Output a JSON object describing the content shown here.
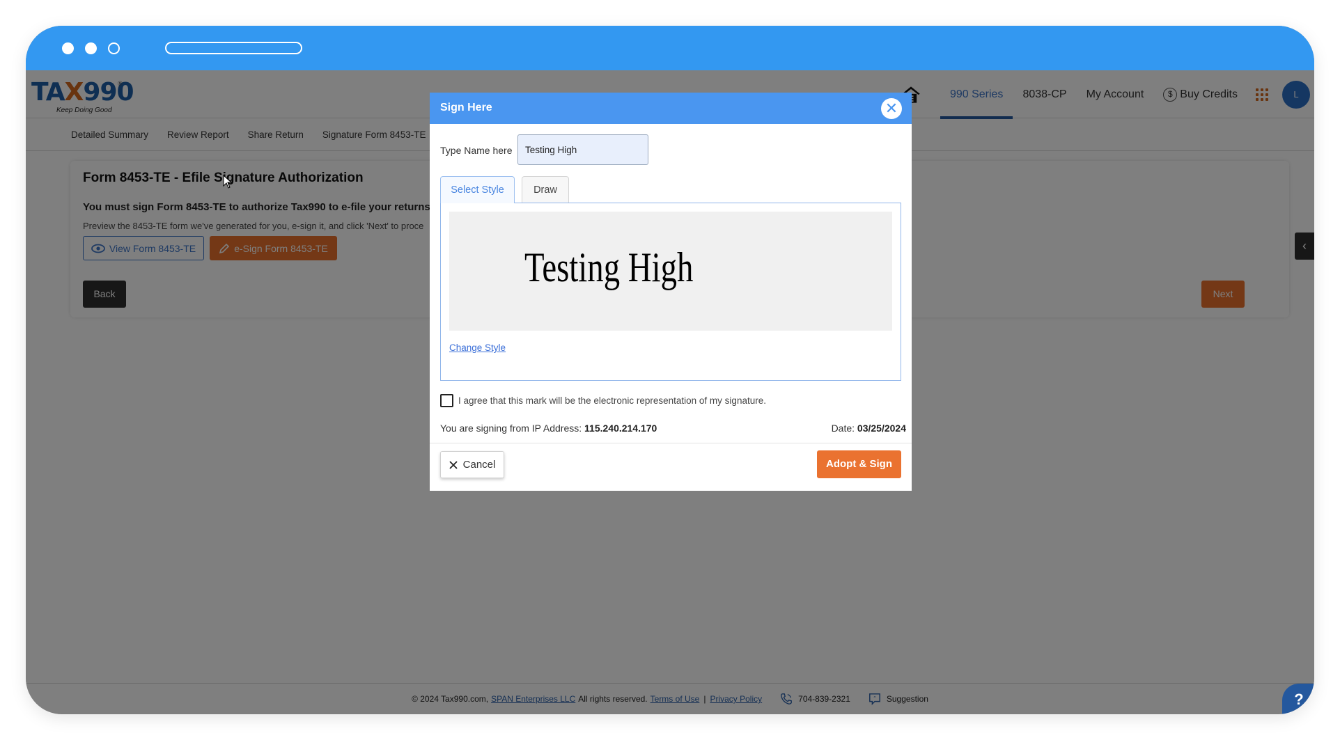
{
  "window": {
    "titlebar_dots": [
      "filled",
      "filled",
      "hollow"
    ]
  },
  "header": {
    "logo": {
      "text_pre": "TA",
      "text_x": "X",
      "text_post": "990",
      "registered": "®",
      "tagline": "Keep Doing Good"
    },
    "nav": [
      {
        "label": "990 Series",
        "active": true
      },
      {
        "label": "8038-CP",
        "active": false
      },
      {
        "label": "My Account",
        "active": false
      },
      {
        "label": "Buy Credits",
        "active": false
      }
    ],
    "credits_symbol": "$",
    "avatar_initial": "L"
  },
  "subnav": {
    "items": [
      "Detailed Summary",
      "Review Report",
      "Share Return",
      "Signature Form 8453-TE"
    ]
  },
  "card": {
    "title": "Form 8453-TE - Efile Signature Authorization",
    "subtitle": "You must sign Form 8453-TE to authorize Tax990 to e-file your returns",
    "description": "Preview the 8453-TE form we've generated for you, e-sign it, and click 'Next' to proce",
    "view_button": "View Form 8453-TE",
    "esign_button": "e-Sign Form 8453-TE",
    "back_button": "Back",
    "next_button": "Next"
  },
  "footer": {
    "copyright": "© 2024 Tax990.com,",
    "company_link": "SPAN Enterprises LLC",
    "rights": "All rights reserved.",
    "terms_link": "Terms of Use",
    "separator": "|",
    "privacy_link": "Privacy Policy",
    "phone": "704-839-2321",
    "suggestion": "Suggestion",
    "help": "?"
  },
  "modal": {
    "title": "Sign Here",
    "close": "✕",
    "name_label": "Type Name here",
    "name_value": "Testing High",
    "tabs": [
      {
        "label": "Select Style",
        "active": true
      },
      {
        "label": "Draw",
        "active": false
      }
    ],
    "signature_preview": "Testing High",
    "change_style_link": "Change Style",
    "agree_checked": false,
    "agree_text": "I agree that this mark will be the electronic representation of my signature.",
    "ip_label": "You are signing from IP Address:",
    "ip_value": "115.240.214.170",
    "date_label": "Date:",
    "date_value": "03/25/2024",
    "cancel_button": "Cancel",
    "adopt_button": "Adopt & Sign"
  },
  "colors": {
    "titlebar": "#3398f1",
    "modal_header": "#4a96f0",
    "accent_orange": "#ea7230",
    "brand_blue": "#24589e"
  }
}
